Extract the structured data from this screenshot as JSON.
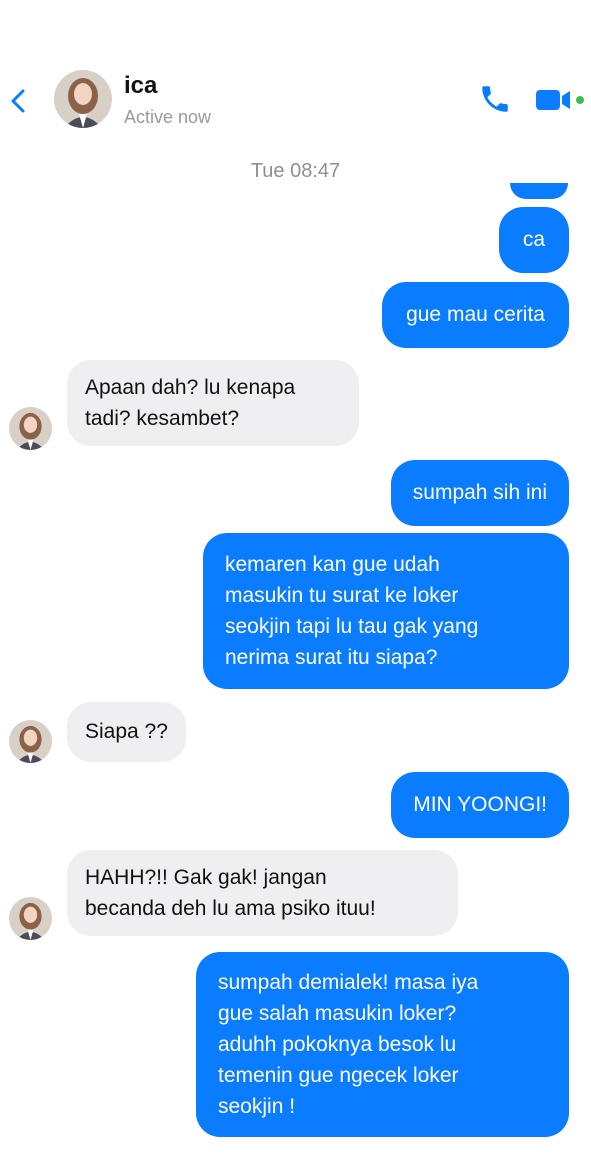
{
  "header": {
    "contact_name": "ica",
    "status": "Active now",
    "back_icon": "chevron-left-icon",
    "call_icon": "phone-icon",
    "video_icon": "video-camera-icon",
    "accent_color": "#0a7cff",
    "online_color": "#3bbf4c"
  },
  "timestamp": "Tue 08:47",
  "messages": [
    {
      "from": "me",
      "text": "ca"
    },
    {
      "from": "me",
      "text": "gue mau cerita"
    },
    {
      "from": "ica",
      "text": "Apaan dah? lu kenapa\ntadi? kesambet?"
    },
    {
      "from": "me",
      "text": "sumpah sih ini"
    },
    {
      "from": "me",
      "text": "kemaren kan gue udah\nmasukin tu surat ke loker\nseokjin tapi lu tau gak yang\nnerima surat itu siapa?"
    },
    {
      "from": "ica",
      "text": "Siapa ??"
    },
    {
      "from": "me",
      "text": "MIN YOONGI!"
    },
    {
      "from": "ica",
      "text": "HAHH?!! Gak gak! jangan\nbecanda deh lu ama psiko ituu!"
    },
    {
      "from": "me",
      "text": "sumpah demialek! masa iya\ngue salah masukin loker?\naduhh pokoknya besok lu\ntemenin gue ngecek loker\nseokjin !"
    }
  ]
}
